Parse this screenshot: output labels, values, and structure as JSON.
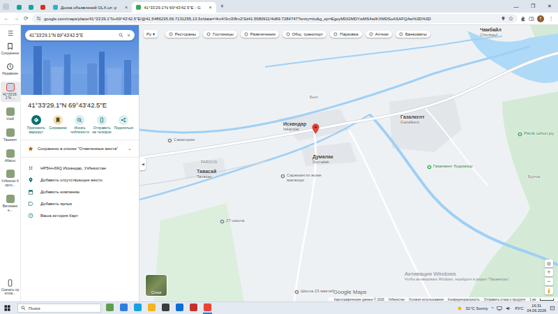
{
  "browser": {
    "tabs": [
      {
        "kind": "icon",
        "selected": false,
        "color": "#12a4a0"
      },
      {
        "kind": "icon",
        "selected": false,
        "color": "#12a4a0"
      },
      {
        "kind": "icon",
        "selected": false,
        "color": "#d93025"
      },
      {
        "kind": "text",
        "label": "Доска объявлений OLX.uz: р",
        "selected": false,
        "color": "#23b8c7"
      },
      {
        "kind": "text",
        "label": "41°33'29.1\"N 69°43'42.5\"E - G",
        "selected": true,
        "color": "#34a853"
      }
    ],
    "tab_close": "×",
    "new_tab": "+",
    "window_controls": [
      "—",
      "❐",
      "✕"
    ],
    "nav": [
      "←",
      "→",
      "⟳"
    ],
    "url": "google.com/maps/place/41°33'29.1\"N+69°43'42.5\"E/@41.5486235,69.7131255,13.5z/data=!4m4!3m3!8m2!3d41.5580911!4d69.7284747?entry=ttu&g_ep=EgoyMDI2MDYwMS4wIKXMDSoASAFQAw%3D%3D",
    "profile": "f",
    "menu": "⋮"
  },
  "rail": {
    "menu": "☰",
    "items": [
      {
        "kind": "saved",
        "label": "Сохранено",
        "selected": false
      },
      {
        "kind": "recent",
        "label": "Недавние",
        "selected": false
      },
      {
        "kind": "place",
        "label": "41°33'29.1\"N ...",
        "selected": true
      },
      {
        "kind": "place",
        "label": "Vodil",
        "selected": false
      },
      {
        "kind": "place",
        "label": "Ташкент",
        "selected": false
      },
      {
        "kind": "place",
        "label": "Aflatun",
        "selected": false
      },
      {
        "kind": "place",
        "label": "Узбекско Кирги...",
        "selected": false
      },
      {
        "kind": "place",
        "label": "Ватикано е...",
        "selected": false
      }
    ],
    "download": "Скачать прилож..."
  },
  "panel": {
    "search_value": "41°33'29.1\"N 69°43'42.5\"E",
    "search_clear": "×",
    "title": "41°33'29.1\"N 69°43'42.5\"E",
    "actions": [
      {
        "kind": "directions",
        "label": "Проложить маршрут",
        "saved": false
      },
      {
        "kind": "save",
        "label": "Сохранено",
        "saved": true
      },
      {
        "kind": "nearby",
        "label": "Искать поблизости",
        "saved": false
      },
      {
        "kind": "send",
        "label": "Отправить на телефон",
        "saved": false
      },
      {
        "kind": "share",
        "label": "Поделиться",
        "saved": false
      }
    ],
    "saved_note": {
      "text": "Сохранено в списке \"Отмеченные места\"",
      "toggle": "⌄"
    },
    "details": [
      {
        "kind": "pluscode",
        "text": "HP5H+69Q Искандар, Узбекистан"
      },
      {
        "kind": "add-place",
        "text": "Добавить отсутствующее место"
      },
      {
        "kind": "add-business",
        "text": "Добавить компанию"
      },
      {
        "kind": "label",
        "text": "Добавить ярлык"
      },
      {
        "kind": "history",
        "text": "Ваша история Карт"
      }
    ]
  },
  "map": {
    "language": "Ру",
    "language_toggle": "▾",
    "chips": [
      "Рестораны",
      "Гостиницы",
      "Развлечения",
      "Общ. транспорт",
      "Парковка",
      "Аптеки",
      "Банкоматы"
    ],
    "labels": [
      {
        "kind": "town",
        "text": "Чамбайл",
        "sub": "Chimbayl"
      },
      {
        "kind": "town",
        "text": "Искандар",
        "sub": "Iskandar"
      },
      {
        "kind": "town",
        "text": "Газалкент",
        "sub": "Gazalkent"
      },
      {
        "kind": "town",
        "text": "Думалак",
        "sub": "Dumalak"
      },
      {
        "kind": "town",
        "text": "Тавасай",
        "sub": "Tavasay"
      },
      {
        "kind": "area",
        "text": "PARGOS"
      },
      {
        "kind": "poi",
        "text": "Санатории"
      },
      {
        "kind": "park",
        "text": "Газалкент бодомзор"
      },
      {
        "kind": "park",
        "text": "Piknik uchun joy"
      },
      {
        "kind": "poi",
        "text": "Саржкангли жоме масжиди"
      },
      {
        "kind": "school",
        "text": "27-школа"
      },
      {
        "kind": "school",
        "text": "Школа 23 мактаб"
      },
      {
        "kind": "area",
        "text": "Бурчок"
      },
      {
        "kind": "area",
        "text": "Бент"
      }
    ],
    "collapse": "◀",
    "layers": "Слои",
    "zoom": [
      "+",
      "−"
    ],
    "logo": "Google Maps",
    "attribution": [
      "Картографические данные © 2026",
      "Узбекистан",
      "Условия использования",
      "Конфиденциальность",
      "Отправить отзыв о продукте",
      "1 км"
    ]
  },
  "watermark": {
    "title": "Активация Windows",
    "text": "Чтобы активировать Windows, перейдите в раздел \"Параметры\"."
  },
  "taskbar": {
    "search": "Поиск",
    "apps": [
      {
        "color": "#5f9e4f",
        "selected": false
      },
      {
        "color": "#2f7de1",
        "selected": false
      },
      {
        "color": "#1aa1e0",
        "selected": false
      },
      {
        "color": "#f3b51b",
        "selected": false
      },
      {
        "color": "#3c3c3c",
        "selected": false
      },
      {
        "color": "#0d6fd6",
        "selected": false
      },
      {
        "color": "#c4312b",
        "selected": false
      },
      {
        "color": "#ea4335",
        "selected": true
      }
    ],
    "weather": "31°C  Sunny",
    "tray_caret": "^",
    "language": "РУС",
    "time": "16:31",
    "date": "04.06.2026"
  }
}
